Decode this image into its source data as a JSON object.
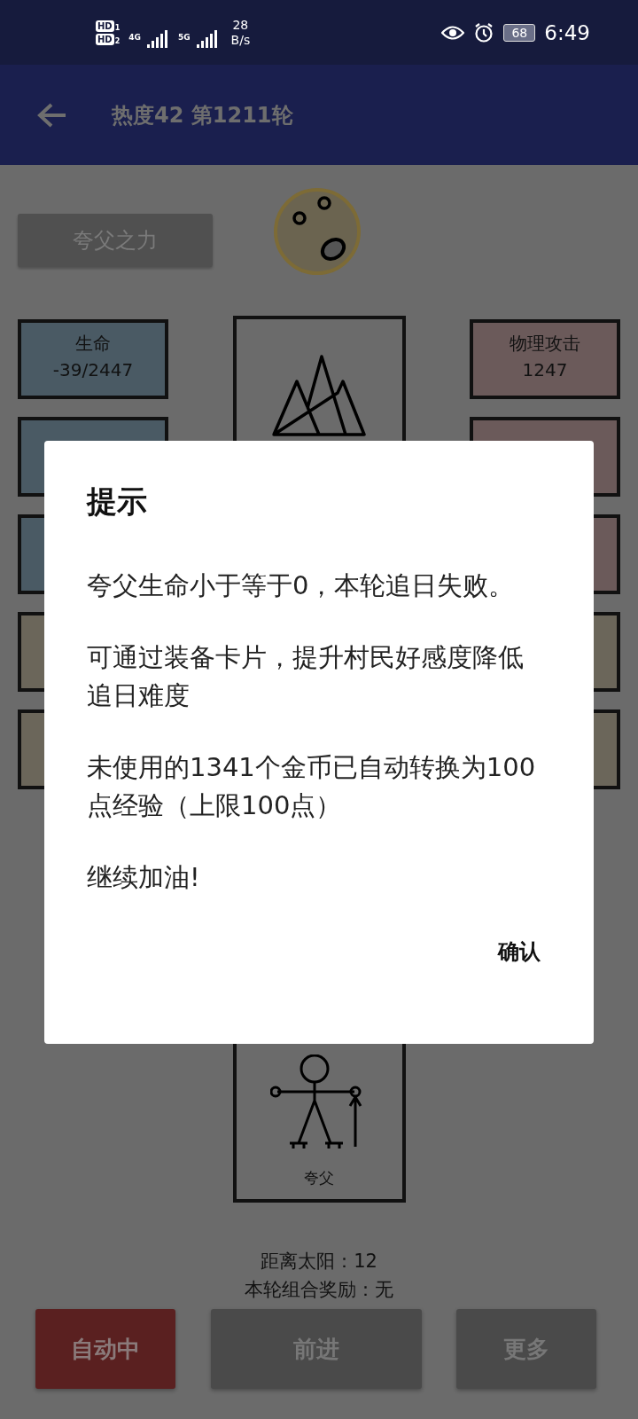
{
  "status_bar": {
    "hd_badges": [
      {
        "label": "HD",
        "slot": "1"
      },
      {
        "label": "HD",
        "slot": "2"
      }
    ],
    "signals": [
      {
        "network": "4G"
      },
      {
        "network": "5G"
      }
    ],
    "speed_value": "28",
    "speed_unit": "B/s",
    "battery": "68",
    "time": "6:49"
  },
  "app_bar": {
    "title": "热度42 第1211轮"
  },
  "power_button": {
    "label": "夸父之力"
  },
  "stats_left": [
    {
      "label": "生命",
      "value": "-39/2447",
      "color": "#4a5a64"
    },
    {
      "color": "#4a5a64"
    },
    {
      "color": "#4a5a64"
    },
    {
      "color": "#6b665a"
    },
    {
      "color": "#6b665a"
    }
  ],
  "stats_right": [
    {
      "label": "物理攻击",
      "value": "1247",
      "color": "#6b5a5a"
    },
    {
      "color": "#6b5a5a"
    },
    {
      "color": "#6b5a5a"
    },
    {
      "color": "#6b665a"
    },
    {
      "color": "#6b665a"
    }
  ],
  "character": {
    "name": "夸父"
  },
  "distance": "距离太阳：12",
  "bonus": "本轮组合奖励：无",
  "buttons": [
    {
      "label": "自动中",
      "kind": "active"
    },
    {
      "label": "前进",
      "kind": "normal"
    },
    {
      "label": "更多",
      "kind": "normal"
    }
  ],
  "dialog": {
    "title": "提示",
    "paragraphs": [
      "夸父生命小于等于0，本轮追日失败。",
      "可通过装备卡片，提升村民好感度降低追日难度",
      "未使用的1341个金币已自动转换为100点经验（上限100点）",
      "继续加油!"
    ],
    "confirm": "确认"
  }
}
